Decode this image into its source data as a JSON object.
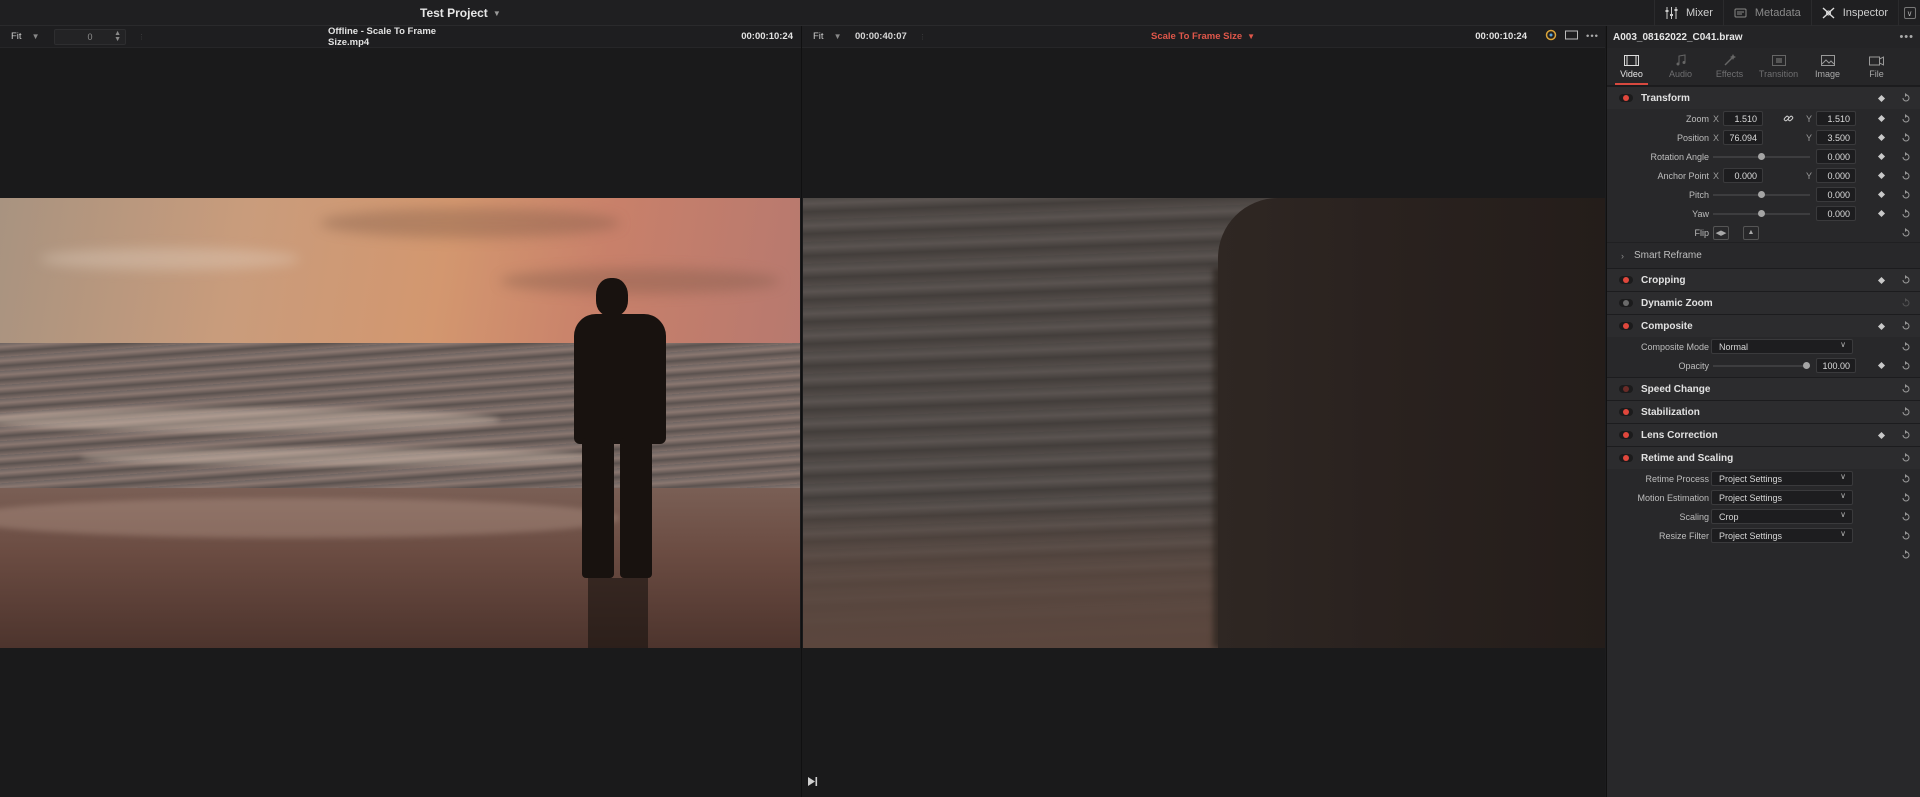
{
  "topbar": {
    "project_title": "Test Project",
    "buttons": [
      {
        "label": "Mixer",
        "icon": "mixer-icon"
      },
      {
        "label": "Metadata",
        "icon": "metadata-icon"
      },
      {
        "label": "Inspector",
        "icon": "inspector-icon"
      }
    ]
  },
  "source_viewer": {
    "fit_label": "Fit",
    "frame_field": "0",
    "clip_name": "Offline - Scale To Frame Size.mp4",
    "timecode": "00:00:10:24"
  },
  "timeline_viewer": {
    "fit_label": "Fit",
    "timecode_left": "00:00:40:07",
    "title": "Scale To Frame Size",
    "title_color": "#e0574a",
    "timecode": "00:00:10:24"
  },
  "inspector": {
    "clip_name": "A003_08162022_C041.braw",
    "tabs": [
      {
        "label": "Video",
        "icon": "video-icon",
        "active": true
      },
      {
        "label": "Audio",
        "icon": "audio-icon",
        "active": false
      },
      {
        "label": "Effects",
        "icon": "effects-icon",
        "active": false
      },
      {
        "label": "Transition",
        "icon": "transition-icon",
        "active": false
      },
      {
        "label": "Image",
        "icon": "image-icon",
        "active": false
      },
      {
        "label": "File",
        "icon": "file-icon",
        "active": false
      }
    ],
    "transform": {
      "title": "Transform",
      "zoom_label": "Zoom",
      "zoom_x": "1.510",
      "zoom_y": "1.510",
      "position_label": "Position",
      "position_x": "76.094",
      "position_y": "3.500",
      "rotation_label": "Rotation Angle",
      "rotation_value": "0.000",
      "anchor_label": "Anchor Point",
      "anchor_x": "0.000",
      "anchor_y": "0.000",
      "pitch_label": "Pitch",
      "pitch_value": "0.000",
      "yaw_label": "Yaw",
      "yaw_value": "0.000",
      "flip_label": "Flip",
      "x_axis": "X",
      "y_axis": "Y"
    },
    "smart_reframe": "Smart Reframe",
    "cropping": "Cropping",
    "dynamic_zoom": "Dynamic Zoom",
    "composite": {
      "title": "Composite",
      "mode_label": "Composite Mode",
      "mode_value": "Normal",
      "opacity_label": "Opacity",
      "opacity_value": "100.00"
    },
    "speed_change": "Speed Change",
    "stabilization": "Stabilization",
    "lens_correction": "Lens Correction",
    "retime": {
      "title": "Retime and Scaling",
      "process_label": "Retime Process",
      "process_value": "Project Settings",
      "motion_label": "Motion Estimation",
      "motion_value": "Project Settings",
      "scaling_label": "Scaling",
      "scaling_value": "Crop",
      "resize_label": "Resize Filter",
      "resize_value": "Project Settings"
    }
  },
  "colors": {
    "accent": "#d8493f",
    "panel": "#28282a",
    "background": "#1c1c1e"
  }
}
